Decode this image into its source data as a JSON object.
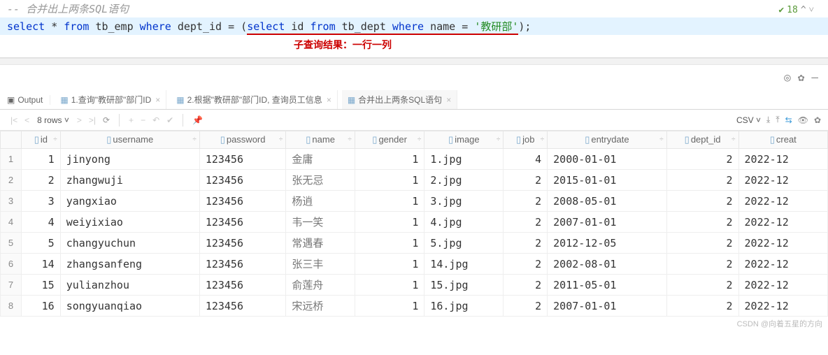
{
  "editor": {
    "comment": "-- 合并出上两条SQL语句",
    "sql_parts": {
      "p1": "select ",
      "p2": "* ",
      "p3": "from ",
      "p4": "tb_emp ",
      "p5": "where ",
      "p6": "dept_id ",
      "p7": "= (",
      "p8": "select ",
      "p9": "id ",
      "p10": "from ",
      "p11": "tb_dept ",
      "p12": "where ",
      "p13": "name ",
      "p14": "= ",
      "p15": "'教研部'",
      "p16": ");"
    },
    "annotation": "子查询结果：一行一列",
    "run_count": "18"
  },
  "tabs": {
    "output": "Output",
    "t1": "1.查询\"教研部\"部门ID",
    "t2": "2.根据\"教研部\"部门ID, 查询员工信息",
    "t3": "合并出上两条SQL语句"
  },
  "toolbar": {
    "rows": "8 rows",
    "csv": "CSV"
  },
  "columns": {
    "id": "id",
    "username": "username",
    "password": "password",
    "name": "name",
    "gender": "gender",
    "image": "image",
    "job": "job",
    "entrydate": "entrydate",
    "dept_id": "dept_id",
    "creat": "creat"
  },
  "rows": [
    {
      "n": "1",
      "id": "1",
      "username": "jinyong",
      "password": "123456",
      "name": "金庸",
      "gender": "1",
      "image": "1.jpg",
      "job": "4",
      "entrydate": "2000-01-01",
      "dept_id": "2",
      "creat": "2022-12"
    },
    {
      "n": "2",
      "id": "2",
      "username": "zhangwuji",
      "password": "123456",
      "name": "张无忌",
      "gender": "1",
      "image": "2.jpg",
      "job": "2",
      "entrydate": "2015-01-01",
      "dept_id": "2",
      "creat": "2022-12"
    },
    {
      "n": "3",
      "id": "3",
      "username": "yangxiao",
      "password": "123456",
      "name": "杨逍",
      "gender": "1",
      "image": "3.jpg",
      "job": "2",
      "entrydate": "2008-05-01",
      "dept_id": "2",
      "creat": "2022-12"
    },
    {
      "n": "4",
      "id": "4",
      "username": "weiyixiao",
      "password": "123456",
      "name": "韦一笑",
      "gender": "1",
      "image": "4.jpg",
      "job": "2",
      "entrydate": "2007-01-01",
      "dept_id": "2",
      "creat": "2022-12"
    },
    {
      "n": "5",
      "id": "5",
      "username": "changyuchun",
      "password": "123456",
      "name": "常遇春",
      "gender": "1",
      "image": "5.jpg",
      "job": "2",
      "entrydate": "2012-12-05",
      "dept_id": "2",
      "creat": "2022-12"
    },
    {
      "n": "6",
      "id": "14",
      "username": "zhangsanfeng",
      "password": "123456",
      "name": "张三丰",
      "gender": "1",
      "image": "14.jpg",
      "job": "2",
      "entrydate": "2002-08-01",
      "dept_id": "2",
      "creat": "2022-12"
    },
    {
      "n": "7",
      "id": "15",
      "username": "yulianzhou",
      "password": "123456",
      "name": "俞莲舟",
      "gender": "1",
      "image": "15.jpg",
      "job": "2",
      "entrydate": "2011-05-01",
      "dept_id": "2",
      "creat": "2022-12"
    },
    {
      "n": "8",
      "id": "16",
      "username": "songyuanqiao",
      "password": "123456",
      "name": "宋远桥",
      "gender": "1",
      "image": "16.jpg",
      "job": "2",
      "entrydate": "2007-01-01",
      "dept_id": "2",
      "creat": "2022-12"
    }
  ],
  "watermark": "CSDN @向着五星的方向"
}
